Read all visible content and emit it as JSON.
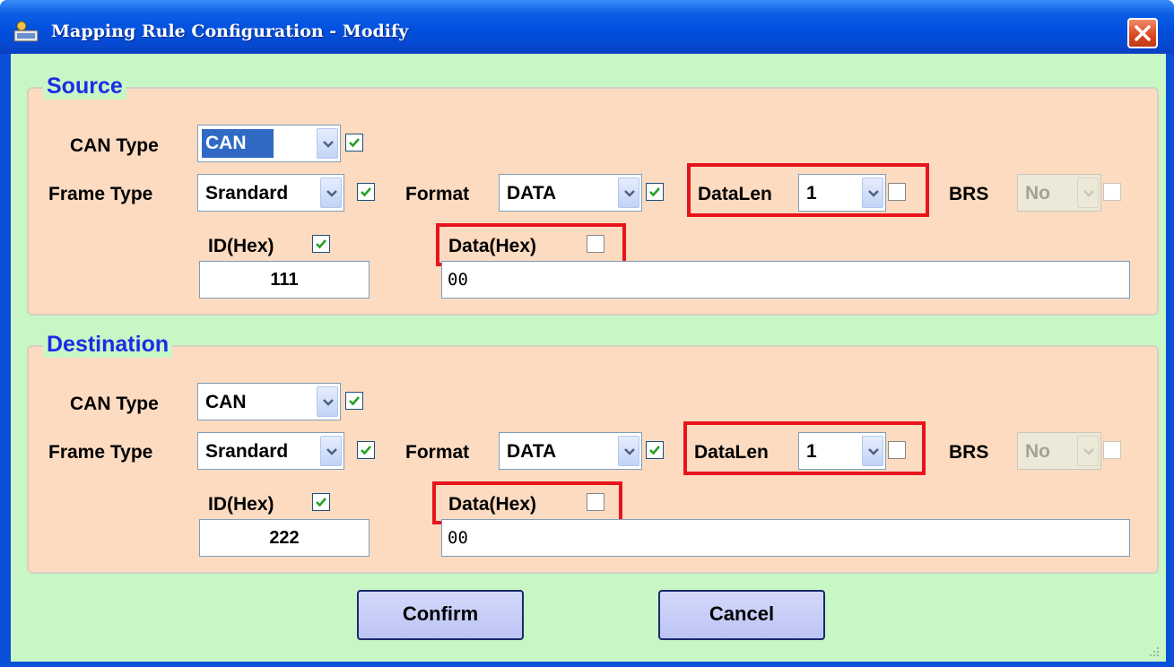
{
  "window": {
    "title": "Mapping Rule Configuration - Modify",
    "icons": {
      "app": "app-window-icon",
      "close": "close-icon"
    }
  },
  "source": {
    "legend": "Source",
    "can_type_label": "CAN Type",
    "can_type_value": "CAN",
    "frame_type_label": "Frame Type",
    "frame_type_value": "Srandard",
    "format_label": "Format",
    "format_value": "DATA",
    "datalen_label": "DataLen",
    "datalen_value": "1",
    "brs_label": "BRS",
    "brs_value": "No",
    "id_label": "ID(Hex)",
    "id_value": "111",
    "data_label": "Data(Hex)",
    "data_value": "00",
    "checks": {
      "can_type": true,
      "frame_type": true,
      "format": true,
      "datalen": false,
      "brs": false,
      "id": true,
      "data": false
    }
  },
  "destination": {
    "legend": "Destination",
    "can_type_label": "CAN Type",
    "can_type_value": "CAN",
    "frame_type_label": "Frame Type",
    "frame_type_value": "Srandard",
    "format_label": "Format",
    "format_value": "DATA",
    "datalen_label": "DataLen",
    "datalen_value": "1",
    "brs_label": "BRS",
    "brs_value": "No",
    "id_label": "ID(Hex)",
    "id_value": "222",
    "data_label": "Data(Hex)",
    "data_value": "00",
    "checks": {
      "can_type": true,
      "frame_type": true,
      "format": true,
      "datalen": false,
      "brs": false,
      "id": true,
      "data": false
    }
  },
  "buttons": {
    "confirm": "Confirm",
    "cancel": "Cancel"
  },
  "colors": {
    "title_bar": "#0050de",
    "client_bg": "#c9f6c5",
    "group_bg": "#fcdbc1",
    "legend_text": "#1b2ce6",
    "highlight": "#e8141c"
  }
}
